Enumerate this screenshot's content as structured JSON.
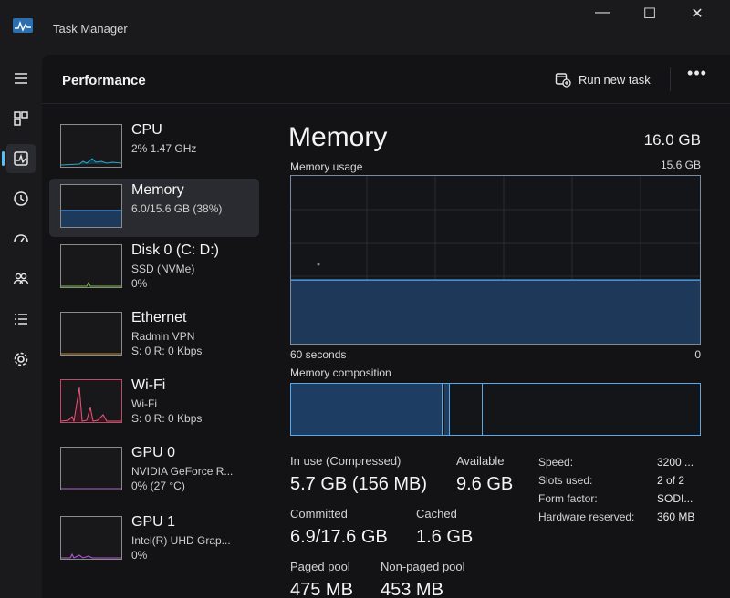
{
  "app": {
    "title": "Task Manager"
  },
  "window_controls": {
    "minimize": "—",
    "maximize": "☐",
    "close": "✕"
  },
  "nav_rail": [
    {
      "icon": "hamburger-menu-icon"
    },
    {
      "icon": "processes-icon"
    },
    {
      "icon": "performance-icon",
      "active": true
    },
    {
      "icon": "app-history-icon"
    },
    {
      "icon": "startup-apps-icon"
    },
    {
      "icon": "users-icon"
    },
    {
      "icon": "details-icon"
    },
    {
      "icon": "services-icon"
    }
  ],
  "header": {
    "title": "Performance",
    "run_task_label": "Run new task",
    "more_label": "•••"
  },
  "devices": [
    {
      "name": "CPU",
      "line1": "2% 1.47 GHz",
      "line2": "",
      "active": false
    },
    {
      "name": "Memory",
      "line1": "6.0/15.6 GB (38%)",
      "line2": "",
      "active": true
    },
    {
      "name": "Disk 0 (C: D:)",
      "line1": "SSD (NVMe)",
      "line2": "0%",
      "active": false
    },
    {
      "name": "Ethernet",
      "line1": "Radmin VPN",
      "line2": "S: 0 R: 0 Kbps",
      "active": false
    },
    {
      "name": "Wi-Fi",
      "line1": "Wi-Fi",
      "line2": "S: 0 R: 0 Kbps",
      "active": false
    },
    {
      "name": "GPU 0",
      "line1": "NVIDIA GeForce R...",
      "line2": "0% (27 °C)",
      "active": false
    },
    {
      "name": "GPU 1",
      "line1": "Intel(R) UHD Grap...",
      "line2": "0%",
      "active": false
    }
  ],
  "detail": {
    "title": "Memory",
    "total": "16.0 GB",
    "usage_label": "Memory usage",
    "usage_max": "15.6 GB",
    "axis_left": "60 seconds",
    "axis_right": "0",
    "composition_label": "Memory composition",
    "usage_fraction": 0.38,
    "stats": {
      "in_use_label": "In use (Compressed)",
      "in_use_value": "5.7 GB (156 MB)",
      "available_label": "Available",
      "available_value": "9.6 GB",
      "committed_label": "Committed",
      "committed_value": "6.9/17.6 GB",
      "cached_label": "Cached",
      "cached_value": "1.6 GB",
      "paged_label": "Paged pool",
      "paged_value": "475 MB",
      "nonpaged_label": "Non-paged pool",
      "nonpaged_value": "453 MB"
    },
    "specs": [
      {
        "label": "Speed:",
        "value": "3200 ..."
      },
      {
        "label": "Slots used:",
        "value": "2 of 2"
      },
      {
        "label": "Form factor:",
        "value": "SODI..."
      },
      {
        "label": "Hardware reserved:",
        "value": "360 MB"
      }
    ]
  },
  "colors": {
    "accent": "#4fc3f7",
    "memory_fill": "#1d3a5c",
    "memory_line": "#3d8bd4",
    "wifi": "#e05a7a",
    "gpu": "#b25fd6"
  }
}
